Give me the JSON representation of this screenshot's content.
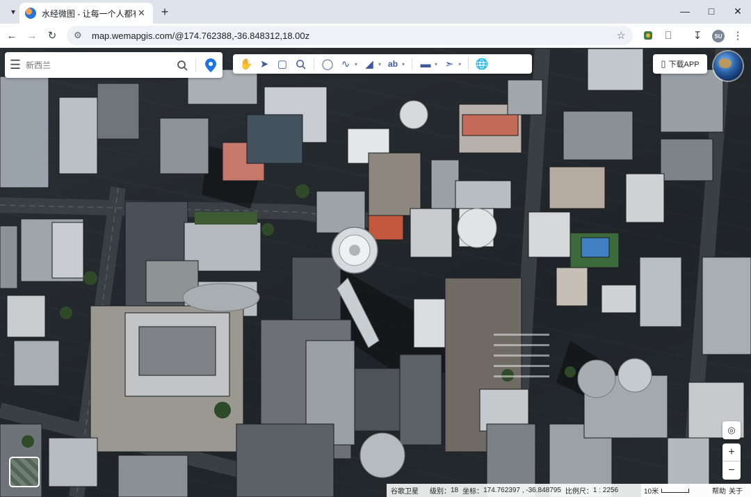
{
  "browser": {
    "tab_title": "水经微图 - 让每一个人都有自己",
    "url": "map.wemapgis.com/@174.762388,-36.848312,18.00z"
  },
  "map": {
    "search_placeholder": "新西兰",
    "app_button_label": "下载APP",
    "status": {
      "source": "谷歌卫星",
      "level_label": "级别：",
      "level": "18",
      "coord_label": "坐标：",
      "coords": "174.762397 , -36.848795",
      "scale_label": "比例尺：",
      "scale": "1 : 2256",
      "scale_bar": "10米",
      "help": "帮助",
      "close": "关于"
    }
  }
}
